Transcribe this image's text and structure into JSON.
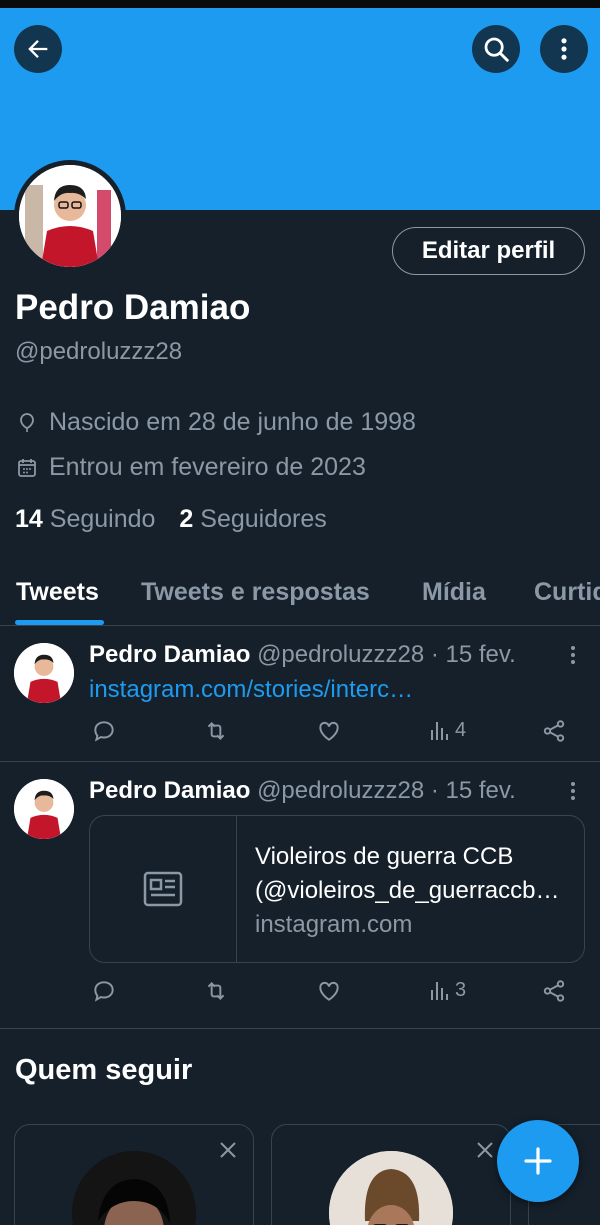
{
  "colors": {
    "banner": "#1d9bf0",
    "accent": "#1d9bf0",
    "background": "#15202b",
    "muted": "#8b98a5",
    "border": "#38444d"
  },
  "header": {
    "icons": {
      "back": "arrow-left-icon",
      "search": "search-icon",
      "more": "more-vertical-icon"
    }
  },
  "profile": {
    "edit_button": "Editar perfil",
    "name": "Pedro Damiao",
    "handle": "@pedroluzzz28",
    "birth": "Nascido em 28 de junho de 1998",
    "joined": "Entrou em fevereiro de 2023",
    "following_count": "14",
    "following_label": "Seguindo",
    "followers_count": "2",
    "followers_label": "Seguidores"
  },
  "tabs": [
    {
      "label": "Tweets",
      "active": true
    },
    {
      "label": "Tweets e respostas",
      "active": false
    },
    {
      "label": "Mídia",
      "active": false
    },
    {
      "label": "Curtidas",
      "active": false
    }
  ],
  "tweets": [
    {
      "name": "Pedro Damiao",
      "handle": "@pedroluzzz28",
      "date": "· 15 fev.",
      "link": "instagram.com/stories/interc…",
      "views": "4"
    },
    {
      "name": "Pedro Damiao",
      "handle": "@pedroluzzz28",
      "date": "· 15 fev.",
      "card": {
        "title_line1": "Violeiros de guerra CCB",
        "title_line2": "(@violeiros_de_guerraccb…",
        "domain": "instagram.com"
      },
      "views": "3"
    }
  ],
  "who_to_follow": {
    "title": "Quem seguir"
  }
}
